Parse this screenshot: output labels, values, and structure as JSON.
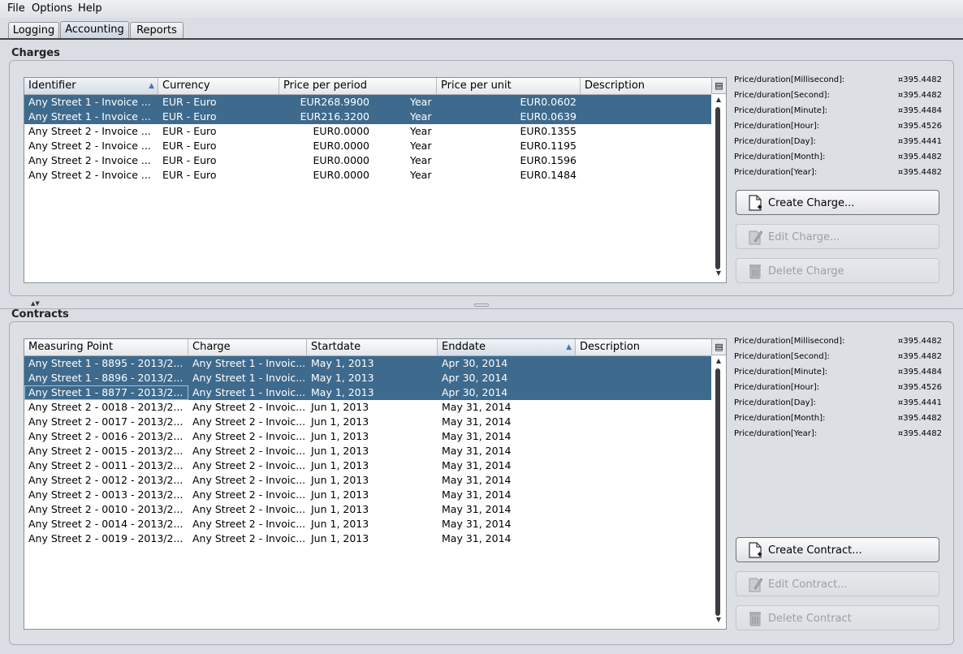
{
  "menu": {
    "file": "File",
    "options": "Options",
    "help": "Help"
  },
  "tabs": [
    "Logging",
    "Accounting",
    "Reports"
  ],
  "active_tab": "Accounting",
  "charges": {
    "title": "Charges",
    "columns": [
      "Identifier",
      "Currency",
      "Price per period",
      "Price per unit",
      "Description"
    ],
    "sorted_column": "Identifier",
    "rows": [
      {
        "identifier": "Any Street 1 - Invoice ...",
        "currency": "EUR - Euro",
        "price_period": "EUR268.9900",
        "period": "Year",
        "price_unit": "EUR0.0602",
        "description": "",
        "selected": true
      },
      {
        "identifier": "Any Street 1 - Invoice ...",
        "currency": "EUR - Euro",
        "price_period": "EUR216.3200",
        "period": "Year",
        "price_unit": "EUR0.0639",
        "description": "",
        "selected": true
      },
      {
        "identifier": "Any Street 2 - Invoice ...",
        "currency": "EUR - Euro",
        "price_period": "EUR0.0000",
        "period": "Year",
        "price_unit": "EUR0.1355",
        "description": "",
        "selected": false
      },
      {
        "identifier": "Any Street 2 - Invoice ...",
        "currency": "EUR - Euro",
        "price_period": "EUR0.0000",
        "period": "Year",
        "price_unit": "EUR0.1195",
        "description": "",
        "selected": false
      },
      {
        "identifier": "Any Street 2 - Invoice ...",
        "currency": "EUR - Euro",
        "price_period": "EUR0.0000",
        "period": "Year",
        "price_unit": "EUR0.1596",
        "description": "",
        "selected": false
      },
      {
        "identifier": "Any Street 2 - Invoice ...",
        "currency": "EUR - Euro",
        "price_period": "EUR0.0000",
        "period": "Year",
        "price_unit": "EUR0.1484",
        "description": "",
        "selected": false
      }
    ],
    "durations": [
      {
        "label": "Price/duration[Millisecond]:",
        "value": "¤395.4482"
      },
      {
        "label": "Price/duration[Second]:",
        "value": "¤395.4482"
      },
      {
        "label": "Price/duration[Minute]:",
        "value": "¤395.4484"
      },
      {
        "label": "Price/duration[Hour]:",
        "value": "¤395.4526"
      },
      {
        "label": "Price/duration[Day]:",
        "value": "¤395.4441"
      },
      {
        "label": "Price/duration[Month]:",
        "value": "¤395.4482"
      },
      {
        "label": "Price/duration[Year]:",
        "value": "¤395.4482"
      }
    ],
    "buttons": {
      "create": "Create Charge...",
      "edit": "Edit Charge...",
      "delete": "Delete Charge"
    }
  },
  "contracts": {
    "title": "Contracts",
    "columns": [
      "Measuring Point",
      "Charge",
      "Startdate",
      "Enddate",
      "Description"
    ],
    "sorted_column": "Enddate",
    "rows": [
      {
        "point": "Any Street 1 - 8895 - 2013/2...",
        "charge": "Any Street 1 - Invoic...",
        "start": "May 1, 2013",
        "end": "Apr 30, 2014",
        "description": "",
        "selected": true
      },
      {
        "point": "Any Street 1 - 8896 - 2013/2...",
        "charge": "Any Street 1 - Invoic...",
        "start": "May 1, 2013",
        "end": "Apr 30, 2014",
        "description": "",
        "selected": true
      },
      {
        "point": "Any Street 1 - 8877 - 2013/2...",
        "charge": "Any Street 1 - Invoic...",
        "start": "May 1, 2013",
        "end": "Apr 30, 2014",
        "description": "",
        "selected": true
      },
      {
        "point": "Any Street 2 - 0018 - 2013/2...",
        "charge": "Any Street 2 - Invoic...",
        "start": "Jun 1, 2013",
        "end": "May 31, 2014",
        "description": "",
        "selected": false
      },
      {
        "point": "Any Street 2 - 0017 - 2013/2...",
        "charge": "Any Street 2 - Invoic...",
        "start": "Jun 1, 2013",
        "end": "May 31, 2014",
        "description": "",
        "selected": false
      },
      {
        "point": "Any Street 2 - 0016 - 2013/2...",
        "charge": "Any Street 2 - Invoic...",
        "start": "Jun 1, 2013",
        "end": "May 31, 2014",
        "description": "",
        "selected": false
      },
      {
        "point": "Any Street 2 - 0015 - 2013/2...",
        "charge": "Any Street 2 - Invoic...",
        "start": "Jun 1, 2013",
        "end": "May 31, 2014",
        "description": "",
        "selected": false
      },
      {
        "point": "Any Street 2 - 0011 - 2013/2...",
        "charge": "Any Street 2 - Invoic...",
        "start": "Jun 1, 2013",
        "end": "May 31, 2014",
        "description": "",
        "selected": false
      },
      {
        "point": "Any Street 2 - 0012 - 2013/2...",
        "charge": "Any Street 2 - Invoic...",
        "start": "Jun 1, 2013",
        "end": "May 31, 2014",
        "description": "",
        "selected": false
      },
      {
        "point": "Any Street 2 - 0013 - 2013/2...",
        "charge": "Any Street 2 - Invoic...",
        "start": "Jun 1, 2013",
        "end": "May 31, 2014",
        "description": "",
        "selected": false
      },
      {
        "point": "Any Street 2 - 0010 - 2013/2...",
        "charge": "Any Street 2 - Invoic...",
        "start": "Jun 1, 2013",
        "end": "May 31, 2014",
        "description": "",
        "selected": false
      },
      {
        "point": "Any Street 2 - 0014 - 2013/2...",
        "charge": "Any Street 2 - Invoic...",
        "start": "Jun 1, 2013",
        "end": "May 31, 2014",
        "description": "",
        "selected": false
      },
      {
        "point": "Any Street 2 - 0019 - 2013/2...",
        "charge": "Any Street 2 - Invoic...",
        "start": "Jun 1, 2013",
        "end": "May 31, 2014",
        "description": "",
        "selected": false
      }
    ],
    "durations": [
      {
        "label": "Price/duration[Millisecond]:",
        "value": "¤395.4482"
      },
      {
        "label": "Price/duration[Second]:",
        "value": "¤395.4482"
      },
      {
        "label": "Price/duration[Minute]:",
        "value": "¤395.4484"
      },
      {
        "label": "Price/duration[Hour]:",
        "value": "¤395.4526"
      },
      {
        "label": "Price/duration[Day]:",
        "value": "¤395.4441"
      },
      {
        "label": "Price/duration[Month]:",
        "value": "¤395.4482"
      },
      {
        "label": "Price/duration[Year]:",
        "value": "¤395.4482"
      }
    ],
    "buttons": {
      "create": "Create Contract...",
      "edit": "Edit Contract...",
      "delete": "Delete Contract"
    }
  },
  "colors": {
    "selection": "#3e6a8d",
    "background": "#dadde3",
    "sort_arrow": "#4a78b0"
  },
  "icons": {
    "create": "new-document-icon",
    "edit": "edit-pencil-icon",
    "delete": "trash-can-icon",
    "column_chooser": "column-chooser-icon"
  }
}
